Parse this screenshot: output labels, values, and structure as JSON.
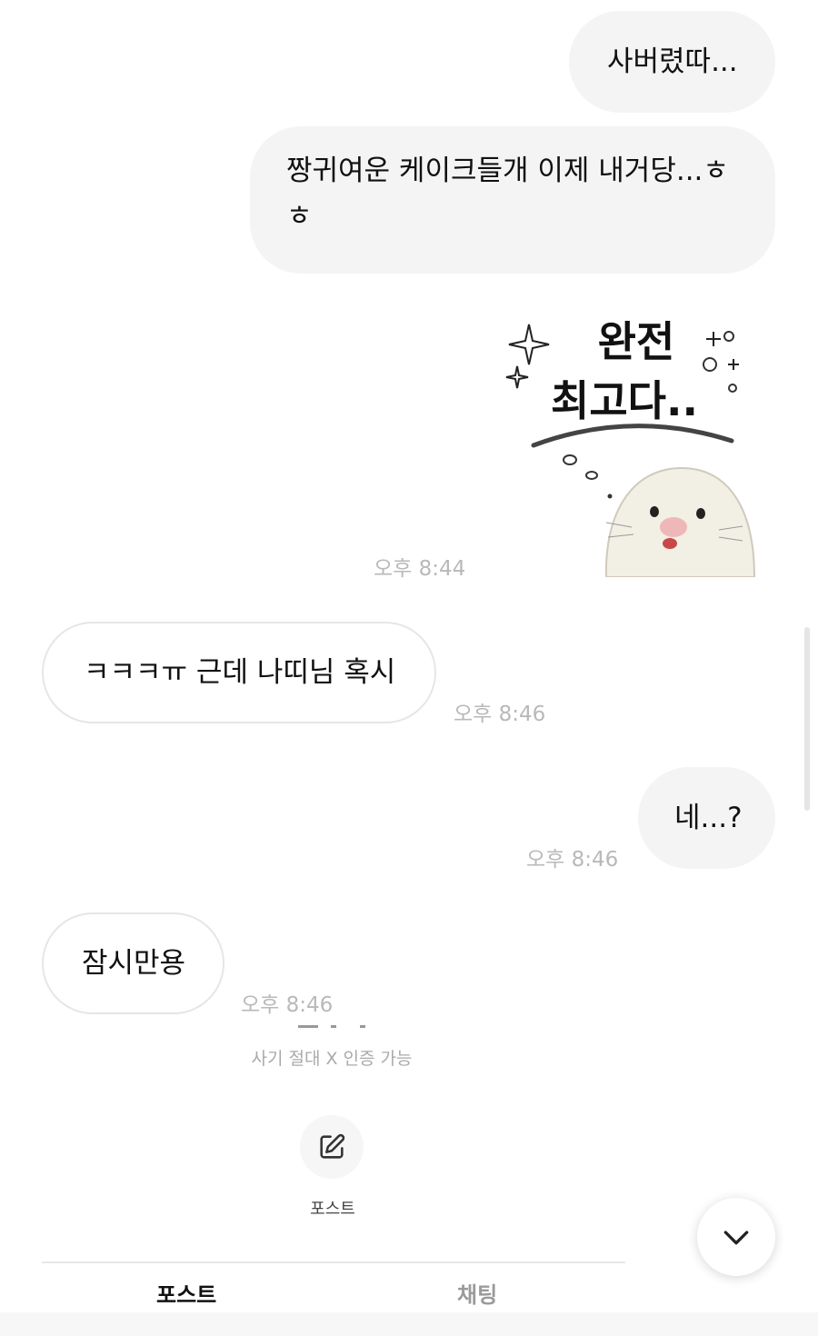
{
  "messages": [
    {
      "type": "sent",
      "text": "사버렸따..."
    },
    {
      "type": "sent",
      "text": "짱귀여운 케이크들개 이제 내거당...ㅎㅎ"
    },
    {
      "type": "sticker",
      "text": "완전 최고다..",
      "time": "오후 8:44"
    },
    {
      "type": "received",
      "text": "ㅋㅋㅋㅠ 근데 나띠님 혹시",
      "time": "오후 8:46"
    },
    {
      "type": "sent",
      "text": "네...?",
      "time": "오후 8:46"
    },
    {
      "type": "received",
      "text": "잠시만용",
      "time": "오후 8:46"
    }
  ],
  "footer": {
    "caption": "사기 절대 X 인증 가능",
    "post_button_label": "포스트",
    "tabs": [
      {
        "label": "포스트",
        "active": true
      },
      {
        "label": "채팅",
        "active": false
      }
    ]
  },
  "icons": {
    "post_button": "pencil-square-icon",
    "scroll_down": "chevron-down-icon"
  },
  "colors": {
    "sent_bubble": "#f4f4f4",
    "timestamp": "#b9b9b9",
    "tab_active": "#111111",
    "tab_inactive": "#9a9a9a"
  }
}
